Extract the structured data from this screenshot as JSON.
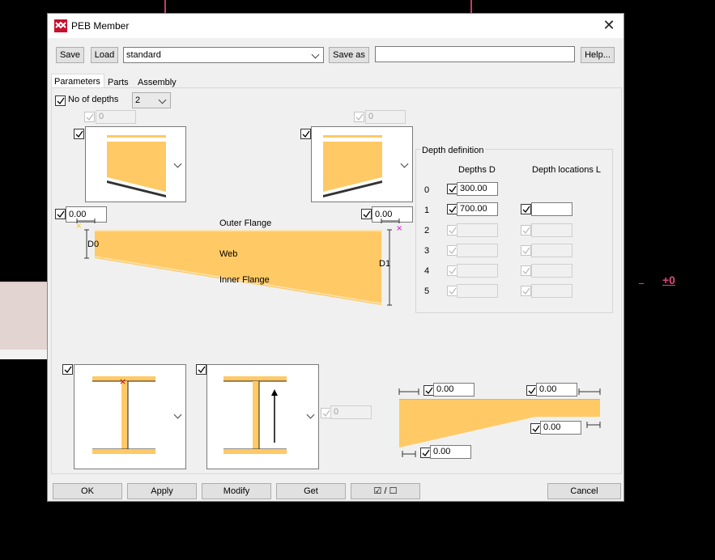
{
  "window": {
    "title": "PEB Member"
  },
  "toolbar": {
    "save_label": "Save",
    "load_label": "Load",
    "preset_value": "standard",
    "saveas_label": "Save as",
    "saveas_value": "",
    "help_label": "Help..."
  },
  "tabs": [
    "Parameters",
    "Parts",
    "Assembly"
  ],
  "params": {
    "no_of_depths_label": "No of depths",
    "no_of_depths_value": "2",
    "top_left_value": "0",
    "top_right_value": "0",
    "left_offset": "0.00",
    "right_offset": "0.00",
    "outer_flange_label": "Outer Flange",
    "web_label": "Web",
    "inner_flange_label": "Inner Flange",
    "d0_label": "D0",
    "d1_label": "D1",
    "section_value": "0"
  },
  "depth_definition": {
    "title": "Depth definition",
    "col_depths": "Depths D",
    "col_locations": "Depth locations L",
    "rows": [
      {
        "index": "0",
        "depth": "300.00",
        "location": ""
      },
      {
        "index": "1",
        "depth": "700.00",
        "location": ""
      },
      {
        "index": "2",
        "depth": "",
        "location": ""
      },
      {
        "index": "3",
        "depth": "",
        "location": ""
      },
      {
        "index": "4",
        "depth": "",
        "location": ""
      },
      {
        "index": "5",
        "depth": "",
        "location": ""
      }
    ]
  },
  "taper": {
    "top_left": "0.00",
    "top_right": "0.00",
    "right_mid": "0.00",
    "bottom_left": "0.00"
  },
  "buttons": {
    "ok": "OK",
    "apply": "Apply",
    "modify": "Modify",
    "get": "Get",
    "toggle": "☑ / ☐",
    "cancel": "Cancel"
  },
  "background": {
    "label": "+0"
  },
  "colors": {
    "member_fill": "#ffc966",
    "member_edge": "#e0a840",
    "accent_pink": "#e0457e"
  }
}
